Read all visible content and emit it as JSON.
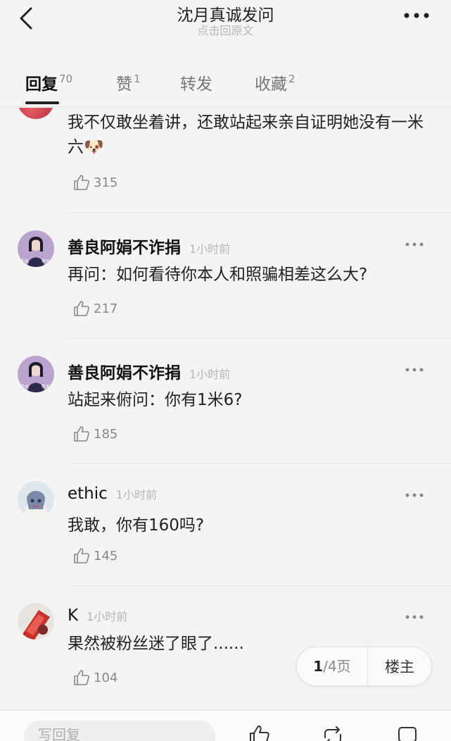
{
  "header": {
    "title": "沈月真诚发问",
    "subtitle": "点击回原文"
  },
  "tabs": [
    {
      "label": "回复",
      "count": "70"
    },
    {
      "label": "赞",
      "count": "1"
    },
    {
      "label": "转发",
      "count": ""
    },
    {
      "label": "收藏",
      "count": "2"
    }
  ],
  "comments": [
    {
      "username": "",
      "time": "",
      "text": "我不仅敢坐着讲，还敢站起来亲自证明她没有一米六🐶",
      "likes": "315"
    },
    {
      "username": "善良阿娟不诈捐",
      "time": "1小时前",
      "text": "再问：如何看待你本人和照骗相差这么大?",
      "likes": "217"
    },
    {
      "username": "善良阿娟不诈捐",
      "time": "1小时前",
      "text": "站起来俯问：你有1米6?",
      "likes": "185"
    },
    {
      "username": "ethic",
      "time": "1小时前",
      "text": "我敢，你有160吗?",
      "likes": "145"
    },
    {
      "username": "K",
      "time": "1小时前",
      "text": "果然被粉丝迷了眼了......",
      "likes": "104"
    }
  ],
  "avatar_labels": {
    "tag_left": "手机",
    "tag_right": "帮卖"
  },
  "pager": {
    "current": "1",
    "rest": "/4页",
    "floor_label": "楼主"
  },
  "bottom": {
    "reply_placeholder": "写回复"
  },
  "colors": {
    "background": "#f4f4f4",
    "text": "#1a1a1a",
    "muted": "#b6b6b6"
  }
}
